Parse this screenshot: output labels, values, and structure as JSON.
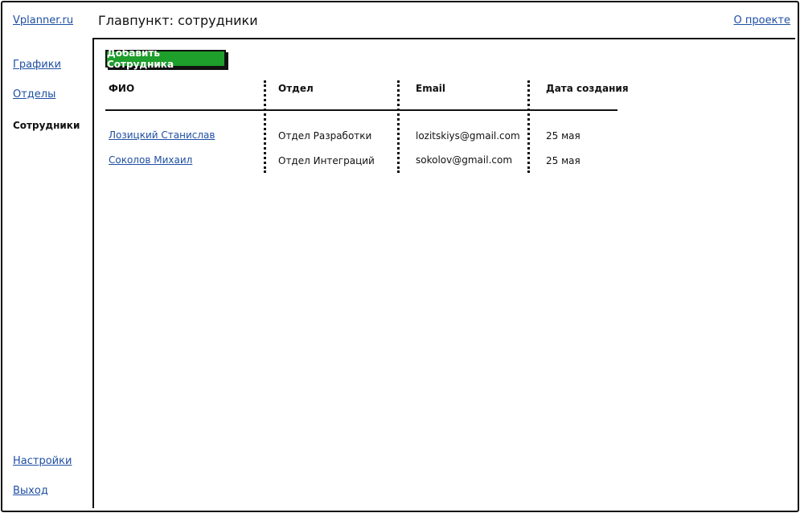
{
  "header": {
    "brand": "Vplanner.ru",
    "title": "Главпункт: сотрудники",
    "about_link": "О проекте"
  },
  "sidebar": {
    "items": [
      {
        "label": "Графики",
        "active": false
      },
      {
        "label": "Отделы",
        "active": false
      },
      {
        "label": "Сотрудники",
        "active": true
      }
    ],
    "bottom_items": [
      {
        "label": "Настройки"
      },
      {
        "label": "Выход"
      }
    ]
  },
  "main": {
    "add_button_label": "Добавить Сотрудника",
    "table": {
      "columns": [
        "ФИО",
        "Отдел",
        "Email",
        "Дата создания"
      ],
      "rows": [
        {
          "name": "Лозицкий Станислав",
          "department": "Отдел Разработки",
          "email": "lozitskiys@gmail.com",
          "created": "25 мая"
        },
        {
          "name": "Соколов Михаил",
          "department": "Отдел Интеграций",
          "email": "sokolov@gmail.com",
          "created": "25 мая"
        }
      ]
    }
  },
  "colors": {
    "accent_button": "#1e9e2a",
    "link": "#1f4fa3",
    "border": "#111111"
  }
}
